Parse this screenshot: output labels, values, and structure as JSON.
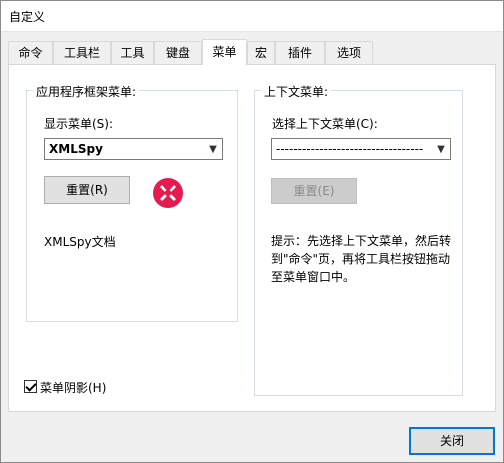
{
  "window": {
    "title": "自定义"
  },
  "tabs": [
    {
      "label": "命令"
    },
    {
      "label": "工具栏"
    },
    {
      "label": "工具"
    },
    {
      "label": "键盘"
    },
    {
      "label": "菜单",
      "active": true
    },
    {
      "label": "宏"
    },
    {
      "label": "插件"
    },
    {
      "label": "选项"
    }
  ],
  "app_menu": {
    "group_label": "应用程序框架菜单:",
    "show_menu_label": "显示菜单(S):",
    "show_menu_value": "XMLSpy",
    "reset_label": "重置(R)",
    "logo_icon": "xmlspy-logo-icon",
    "doc_label": "XMLSpy文档"
  },
  "context_menu": {
    "group_label": "上下文菜单:",
    "select_label": "选择上下文菜单(C):",
    "select_value": "----------------------------------",
    "reset_label": "重置(E)",
    "hint": "提示：先选择上下文菜单，然后转到\"命令\"页，再将工具栏按钮拖动至菜单窗口中。"
  },
  "menu_shadow": {
    "label": "菜单阴影(H)",
    "checked": true
  },
  "close_label": "关闭",
  "colors": {
    "logo_red": "#e31b4f",
    "focus_blue": "#0078d7"
  }
}
